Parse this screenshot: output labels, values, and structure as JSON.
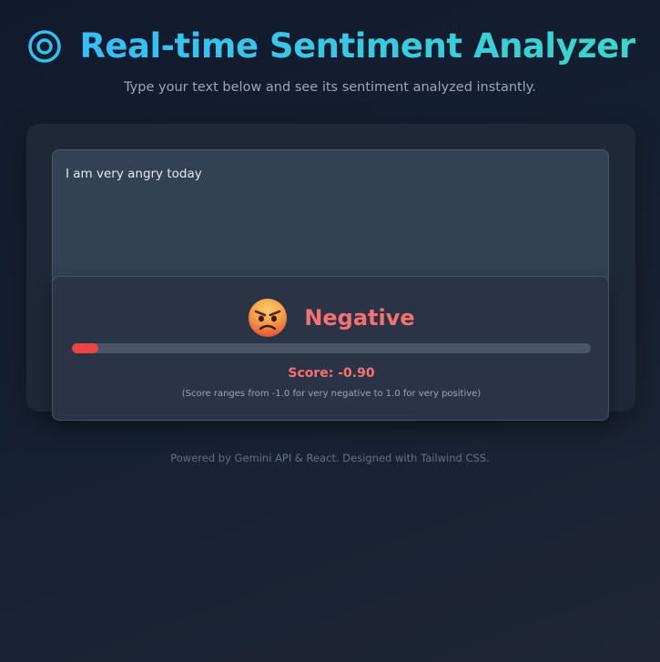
{
  "header": {
    "logo_icon": "target-icon",
    "title": "Real-time Sentiment Analyzer",
    "subtitle": "Type your text below and see its sentiment analyzed instantly."
  },
  "input": {
    "value": "I am very angry today"
  },
  "result": {
    "emoji_icon": "angry-face-icon",
    "label": "Negative",
    "score_text": "Score: -0.90",
    "score_value": -0.9,
    "score_range": [
      -1.0,
      1.0
    ],
    "note": "(Score ranges from -1.0 for very negative to 1.0 for very positive)"
  },
  "footer": {
    "text": "Powered by Gemini API & React. Designed with Tailwind CSS."
  },
  "colors": {
    "accent_start": "#38bdf8",
    "accent_end": "#3ad6c9",
    "negative": "#f87171",
    "bar_fill": "#ef4444"
  }
}
